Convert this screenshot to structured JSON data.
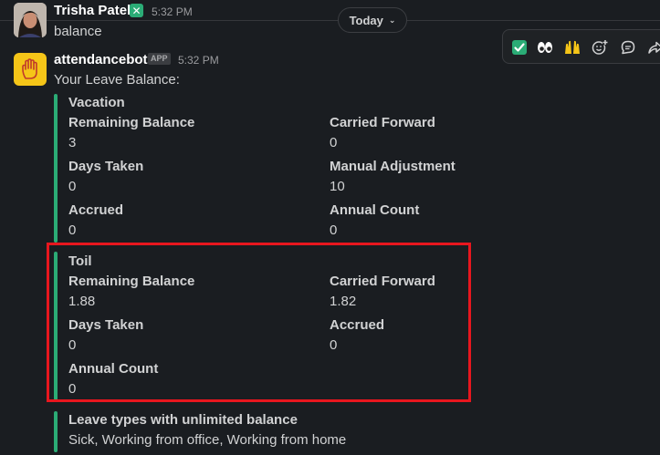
{
  "date_divider": {
    "label": "Today"
  },
  "messages": [
    {
      "author": "Trisha Patel",
      "time": "5:32 PM",
      "text": "balance"
    },
    {
      "author": "attendancebot",
      "badge": "APP",
      "time": "5:32 PM",
      "intro": "Your Leave Balance:",
      "attachments": [
        {
          "title": "Vacation",
          "fields": [
            {
              "label": "Remaining Balance",
              "value": "3"
            },
            {
              "label": "Carried Forward",
              "value": "0"
            },
            {
              "label": "Days Taken",
              "value": "0"
            },
            {
              "label": "Manual Adjustment",
              "value": "10"
            },
            {
              "label": "Accrued",
              "value": "0"
            },
            {
              "label": "Annual Count",
              "value": "0"
            }
          ]
        },
        {
          "title": "Toil",
          "fields": [
            {
              "label": "Remaining Balance",
              "value": "1.88"
            },
            {
              "label": "Carried Forward",
              "value": "1.82"
            },
            {
              "label": "Days Taken",
              "value": "0"
            },
            {
              "label": "Accrued",
              "value": "0"
            },
            {
              "label": "Annual Count",
              "value": "0"
            }
          ]
        },
        {
          "title": "Leave types with unlimited balance",
          "text": "Sick, Working from office, Working from home"
        }
      ]
    }
  ],
  "reaction_bar": {
    "items": [
      "check-mark-emoji",
      "eyes-emoji",
      "raised-hands-emoji",
      "add-reaction-icon",
      "reply-in-thread-icon",
      "share-icon"
    ]
  },
  "colors": {
    "background": "#1a1d21",
    "attachment_bar": "#2bac76",
    "highlight_box": "#e8161e",
    "bot_avatar": "#f5c518"
  }
}
